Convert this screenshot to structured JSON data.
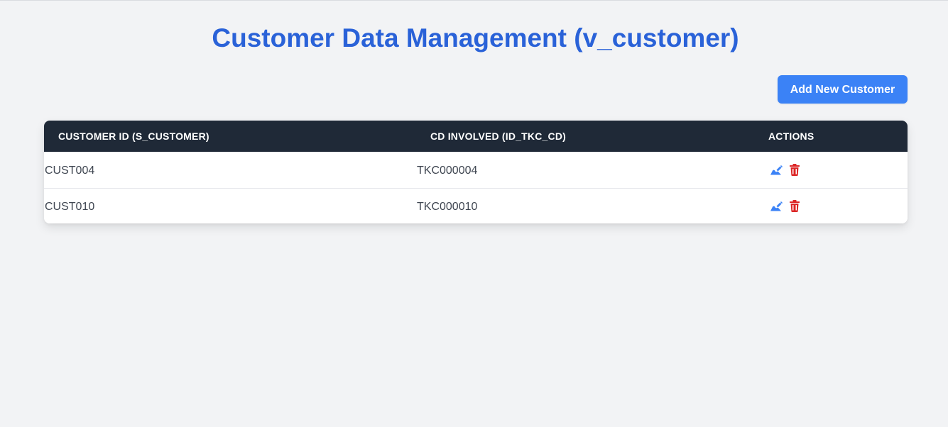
{
  "header": {
    "title": "Customer Data Management (v_customer)"
  },
  "toolbar": {
    "add_label": "Add New Customer"
  },
  "table": {
    "columns": [
      "CUSTOMER ID (S_CUSTOMER)",
      "CD INVOLVED (ID_TKC_CD)",
      "ACTIONS"
    ],
    "rows": [
      {
        "customer_id": "CUST004",
        "cd_involved": "TKC000004"
      },
      {
        "customer_id": "CUST010",
        "cd_involved": "TKC000010"
      }
    ],
    "action_icons": [
      "edit-icon",
      "trash-icon"
    ]
  },
  "colors": {
    "title": "#2a62d8",
    "button": "#3b82f6",
    "header_bg": "#1f2937",
    "edit": "#3b82f6",
    "delete": "#dc2626",
    "page_bg": "#f2f3f5"
  }
}
